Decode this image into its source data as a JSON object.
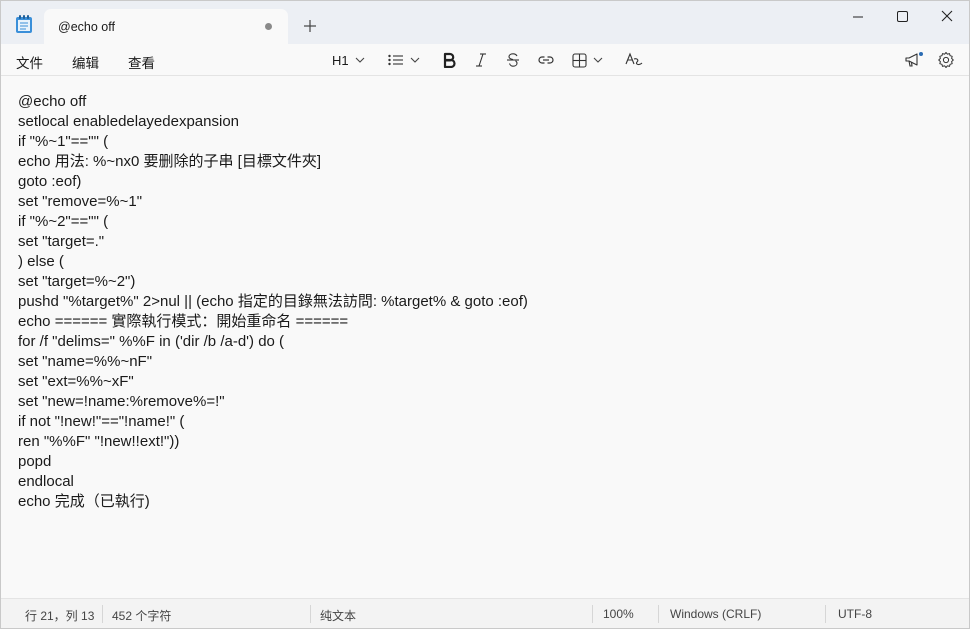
{
  "tab": {
    "title": "@echo off"
  },
  "menu": {
    "file": "文件",
    "edit": "编辑",
    "view": "查看"
  },
  "toolbar": {
    "heading": "H1"
  },
  "editor": {
    "lines": [
      "@echo off",
      "setlocal enabledelayedexpansion",
      "if \"%~1\"==\"\" (",
      "echo 用法: %~nx0 要删除的子串 [目標文件夾]",
      "goto :eof)",
      "set \"remove=%~1\"",
      "if \"%~2\"==\"\" (",
      "set \"target=.\"",
      ") else (",
      "set \"target=%~2\")",
      "pushd \"%target%\" 2>nul || (echo 指定的目錄無法訪問: %target% & goto :eof)",
      "echo ====== 實際執行模式：開始重命名 ======",
      "for /f \"delims=\" %%F in ('dir /b /a-d') do (",
      "set \"name=%%~nF\"",
      "set \"ext=%%~xF\"",
      "set \"new=!name:%remove%=!\"",
      "if not \"!new!\"==\"!name!\" (",
      "ren \"%%F\" \"!new!!ext!\"))",
      "popd",
      "endlocal",
      "echo 完成（已執行)"
    ]
  },
  "status": {
    "position": "行 21，列 13",
    "chars": "452 个字符",
    "format": "纯文本",
    "zoom": "100%",
    "line_ending": "Windows (CRLF)",
    "encoding": "UTF-8"
  }
}
